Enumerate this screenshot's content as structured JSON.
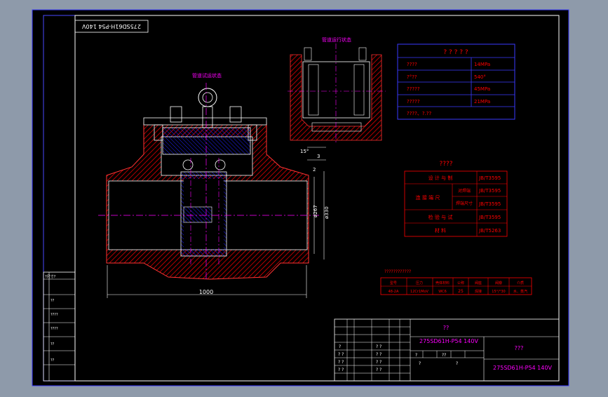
{
  "colors": {
    "background": "#000000",
    "frame": "#3a3aff",
    "section": "#ff0000",
    "outline": "#ffffff",
    "centerline": "#ff00ff",
    "dimension": "#ffffff",
    "hatch": "#0000ff",
    "label": "#ff00ff",
    "viewport_bg": "#8e9aaa"
  },
  "drawing": {
    "model_stamp": "275SD61H-P54 140V",
    "state_label_left": "管道试运状态",
    "state_label_right": "管道运行状态",
    "dimensions": {
      "length": "1000",
      "dia_inner": "ø267",
      "dia_outer": "ø330",
      "angle": "15°",
      "small_1": "2",
      "small_2": "3"
    }
  },
  "param_table": {
    "title": "? ? ? ? ?",
    "rows": [
      {
        "label": "????",
        "value": "14MPa"
      },
      {
        "label": "?°??",
        "value": "540°"
      },
      {
        "label": "?????",
        "value": "45MPa"
      },
      {
        "label": "?????",
        "value": "21MPa"
      },
      {
        "label": "????、?.??",
        "value": ""
      }
    ]
  },
  "std_table": {
    "title": "????",
    "rows": [
      {
        "label": "设 计 与 制",
        "sub": "",
        "value": "JB/T3595"
      },
      {
        "label": "连 接 端 尺",
        "sub": "对焊端",
        "value": "JB/T3595"
      },
      {
        "label": "",
        "sub": "焊端尺寸",
        "value": "JB/T3595"
      },
      {
        "label": "检 验 与 试",
        "sub": "",
        "value": "JB/T3595"
      },
      {
        "label": "材 料",
        "sub": "",
        "value": "JB/T5263"
      }
    ]
  },
  "spec_table": {
    "title": "????????????",
    "headers": [
      "型号",
      "压力",
      "壳体材料",
      "公称",
      "阀座",
      "阀瓣",
      "介质"
    ],
    "values": [
      "48-2A",
      "12Cr1MoV",
      "WC6",
      "25",
      "焊接",
      "15°/°30",
      "水、蒸汽"
    ]
  },
  "left_strip": {
    "labels": [
      "?尺寸?",
      "??",
      "????",
      "????",
      "??",
      "??"
    ]
  },
  "title_block": {
    "label_main": "??",
    "model_main": "275SD61H-P54 140V",
    "label_right": "???",
    "model_right": "275SD61H-P54 140V",
    "left_col": [
      "?",
      "? ?",
      "? ?",
      "? ?"
    ],
    "mid_col": [
      "? ?",
      "? ?",
      "? ?",
      "? ?"
    ],
    "bottom_cells": [
      "?",
      "??",
      "?",
      "?"
    ]
  }
}
